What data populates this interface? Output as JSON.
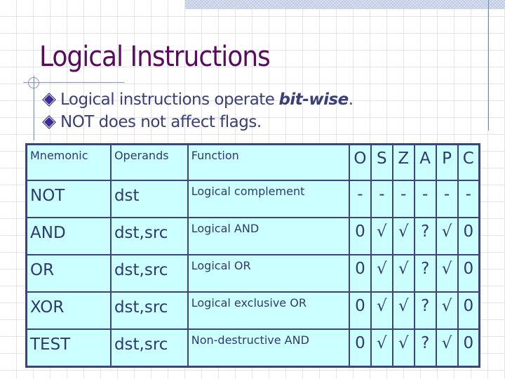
{
  "slide": {
    "title": "Logical Instructions",
    "bullets": [
      {
        "text": "Logical instructions operate",
        "emphasis": "bit-wise",
        "suffix": "."
      },
      {
        "text": "NOT does not affect flags.",
        "emphasis": "",
        "suffix": ""
      }
    ]
  },
  "table": {
    "headers": {
      "mnemonic": "Mnemonic",
      "operands": "Operands",
      "function": "Function",
      "flags": [
        "O",
        "S",
        "Z",
        "A",
        "P",
        "C"
      ]
    },
    "rows": [
      {
        "mnemonic": "NOT",
        "operands": "dst",
        "function": "Logical complement",
        "flags": [
          "-",
          "-",
          "-",
          "-",
          "-",
          "-"
        ]
      },
      {
        "mnemonic": "AND",
        "operands": "dst,src",
        "function": "Logical AND",
        "flags": [
          "0",
          "√",
          "√",
          "?",
          "√",
          "0"
        ]
      },
      {
        "mnemonic": "OR",
        "operands": "dst,src",
        "function": "Logical OR",
        "flags": [
          "0",
          "√",
          "√",
          "?",
          "√",
          "0"
        ]
      },
      {
        "mnemonic": "XOR",
        "operands": "dst,src",
        "function": "Logical exclusive OR",
        "flags": [
          "0",
          "√",
          "√",
          "?",
          "√",
          "0"
        ]
      },
      {
        "mnemonic": "TEST",
        "operands": "dst,src",
        "function": "Non-destructive AND",
        "flags": [
          "0",
          "√",
          "√",
          "?",
          "√",
          "0"
        ]
      }
    ]
  },
  "colors": {
    "title": "#5a0b5e",
    "body_text": "#3a3f78",
    "table_fill": "#ccffff",
    "table_border": "#3c4478"
  }
}
